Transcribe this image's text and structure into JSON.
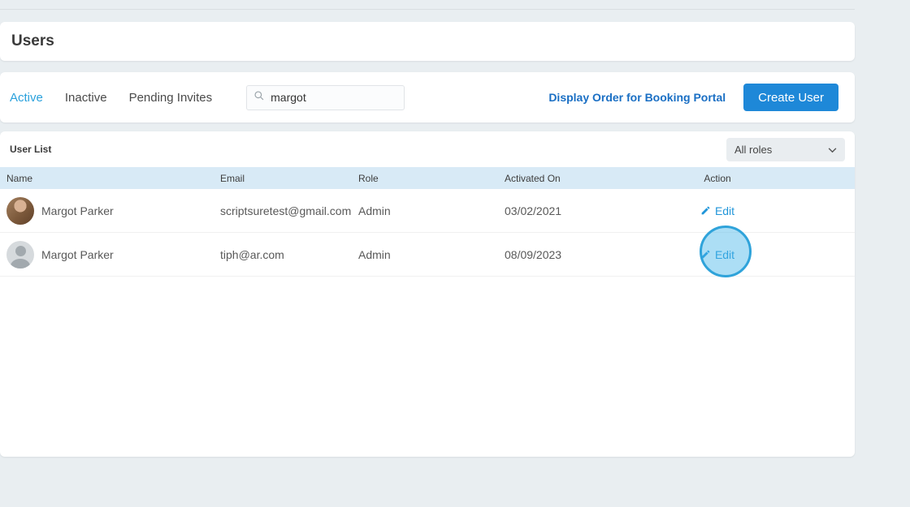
{
  "page": {
    "title": "Users"
  },
  "tabs": [
    {
      "label": "Active",
      "active": true
    },
    {
      "label": "Inactive",
      "active": false
    },
    {
      "label": "Pending Invites",
      "active": false
    }
  ],
  "search": {
    "value": "margot"
  },
  "toolbar": {
    "display_order_link": "Display Order for Booking Portal",
    "create_user_label": "Create User"
  },
  "list": {
    "title": "User List",
    "roles_filter": "All roles",
    "columns": [
      "Name",
      "Email",
      "Role",
      "Activated On",
      "Action"
    ],
    "rows": [
      {
        "name": "Margot Parker",
        "email": "scriptsuretest@gmail.com",
        "role": "Admin",
        "activated_on": "03/02/2021",
        "action": "Edit",
        "avatar": "photo"
      },
      {
        "name": "Margot Parker",
        "email": "tiph@ar.com",
        "role": "Admin",
        "activated_on": "08/09/2023",
        "action": "Edit",
        "avatar": "placeholder",
        "highlighted": true
      }
    ]
  },
  "colors": {
    "accent_blue": "#2196d9",
    "tab_active": "#2aa1dc",
    "link_blue": "#1a6fc4",
    "button_blue": "#1e88d8",
    "table_header_bg": "#d8eaf6",
    "highlight_circle": "#48b6e8",
    "page_bg": "#e9eef1"
  }
}
